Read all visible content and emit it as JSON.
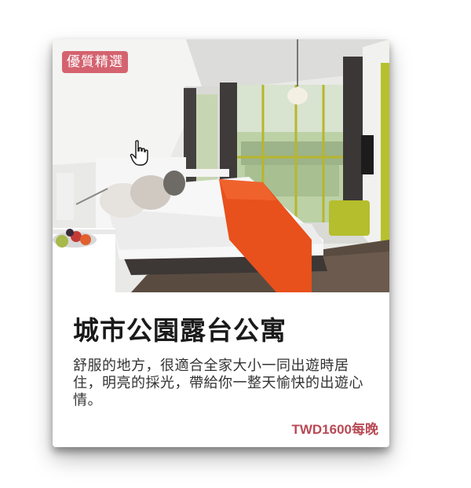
{
  "card": {
    "badge": "優質精選",
    "title": "城市公園露台公寓",
    "description": "舒服的地方，很適合全家大小一同出遊時居住，明亮的採光，帶給你一整天愉快的出遊心情。",
    "price": "TWD1600每晚",
    "image_icon": "hotel-room-photo",
    "cursor_icon": "hand-pointer-icon"
  },
  "colors": {
    "badge_bg": "#d4636f",
    "price_text": "#b84a55",
    "bed_runner": "#e8501c"
  }
}
